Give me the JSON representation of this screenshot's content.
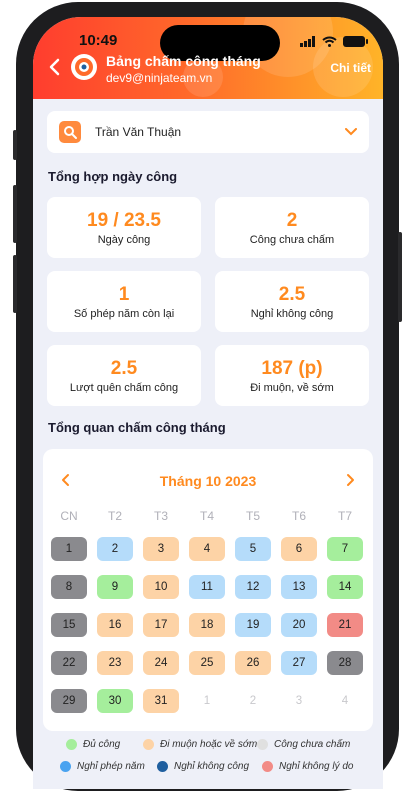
{
  "status_bar": {
    "time": "10:49"
  },
  "header": {
    "title": "Bảng chấm công tháng",
    "email": "dev9@ninjateam.vn",
    "action": "Chi tiết"
  },
  "employee_select": {
    "selected": "Trần Văn Thuận"
  },
  "summary": {
    "title": "Tổng hợp ngày công",
    "stats": [
      {
        "value": "19 / 23.5",
        "label": "Ngày công"
      },
      {
        "value": "2",
        "label": "Công chưa chấm"
      },
      {
        "value": "1",
        "label": "Số phép năm còn lại"
      },
      {
        "value": "2.5",
        "label": "Nghỉ không công"
      },
      {
        "value": "2.5",
        "label": "Lượt quên chấm công"
      },
      {
        "value": "187 (p)",
        "label": "Đi muộn, về sớm"
      }
    ]
  },
  "calendar": {
    "section_title": "Tổng quan chấm công tháng",
    "month_label": "Tháng 10 2023",
    "weekdays": [
      "CN",
      "T2",
      "T3",
      "T4",
      "T5",
      "T6",
      "T7"
    ],
    "days": [
      {
        "d": "1",
        "s": "gray"
      },
      {
        "d": "2",
        "s": "blue"
      },
      {
        "d": "3",
        "s": "orange"
      },
      {
        "d": "4",
        "s": "orange"
      },
      {
        "d": "5",
        "s": "blue"
      },
      {
        "d": "6",
        "s": "orange"
      },
      {
        "d": "7",
        "s": "green"
      },
      {
        "d": "8",
        "s": "gray"
      },
      {
        "d": "9",
        "s": "green"
      },
      {
        "d": "10",
        "s": "orange"
      },
      {
        "d": "11",
        "s": "blue"
      },
      {
        "d": "12",
        "s": "blue"
      },
      {
        "d": "13",
        "s": "blue"
      },
      {
        "d": "14",
        "s": "green"
      },
      {
        "d": "15",
        "s": "gray"
      },
      {
        "d": "16",
        "s": "orange"
      },
      {
        "d": "17",
        "s": "orange"
      },
      {
        "d": "18",
        "s": "orange"
      },
      {
        "d": "19",
        "s": "blue"
      },
      {
        "d": "20",
        "s": "blue"
      },
      {
        "d": "21",
        "s": "red"
      },
      {
        "d": "22",
        "s": "gray"
      },
      {
        "d": "23",
        "s": "orange"
      },
      {
        "d": "24",
        "s": "orange"
      },
      {
        "d": "25",
        "s": "orange"
      },
      {
        "d": "26",
        "s": "orange"
      },
      {
        "d": "27",
        "s": "blue"
      },
      {
        "d": "28",
        "s": "gray"
      },
      {
        "d": "29",
        "s": "gray"
      },
      {
        "d": "30",
        "s": "green"
      },
      {
        "d": "31",
        "s": "orange"
      },
      {
        "d": "1",
        "s": "empty"
      },
      {
        "d": "2",
        "s": "empty"
      },
      {
        "d": "3",
        "s": "empty"
      },
      {
        "d": "4",
        "s": "empty"
      }
    ]
  },
  "status_colors": {
    "gray": "#8a8a8e",
    "blue": "#b5dcfa",
    "orange": "#fdd3a6",
    "green": "#a5ee9c",
    "red": "#f28b86"
  },
  "legend": [
    {
      "label": "Đủ công",
      "color": "#a5ee9c"
    },
    {
      "label": "Đi muộn hoặc về sớm",
      "color": "#fdd3a6"
    },
    {
      "label": "Công chưa chấm",
      "color": "#e0e0e0"
    },
    {
      "label": "Nghỉ phép năm",
      "color": "#4aa3f0"
    },
    {
      "label": "Nghỉ không công",
      "color": "#1f5f9f"
    },
    {
      "label": "Nghỉ không lý do",
      "color": "#f28b86"
    }
  ],
  "accent_color": "#ff8a1f"
}
